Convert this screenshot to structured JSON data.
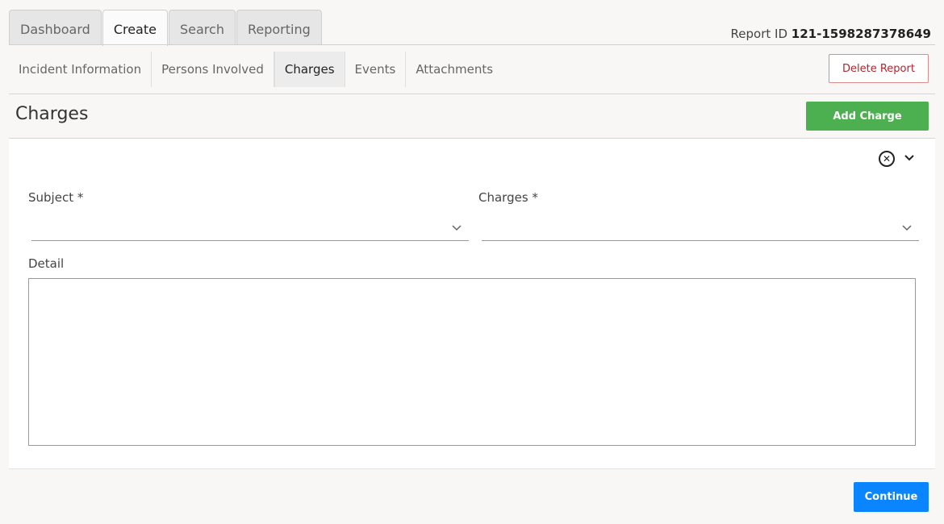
{
  "top_tabs": [
    {
      "label": "Dashboard",
      "active": false
    },
    {
      "label": "Create",
      "active": true
    },
    {
      "label": "Search",
      "active": false
    },
    {
      "label": "Reporting",
      "active": false
    }
  ],
  "report": {
    "id_label": "Report ID",
    "id_value": "121-1598287378649"
  },
  "sub_tabs": [
    {
      "label": "Incident Information",
      "active": false
    },
    {
      "label": "Persons Involved",
      "active": false
    },
    {
      "label": "Charges",
      "active": true
    },
    {
      "label": "Events",
      "active": false
    },
    {
      "label": "Attachments",
      "active": false
    }
  ],
  "actions": {
    "delete_label": "Delete Report",
    "add_label": "Add Charge",
    "continue_label": "Continue"
  },
  "section": {
    "title": "Charges"
  },
  "form": {
    "subject_label": "Subject *",
    "subject_value": "",
    "charges_label": "Charges *",
    "charges_value": "",
    "detail_label": "Detail",
    "detail_value": ""
  },
  "icons": {
    "close": "close-circle-icon",
    "collapse": "chevron-down-icon"
  },
  "colors": {
    "add_button": "#4caf50",
    "continue_button": "#0a84ff",
    "delete_text": "#b0262e"
  }
}
